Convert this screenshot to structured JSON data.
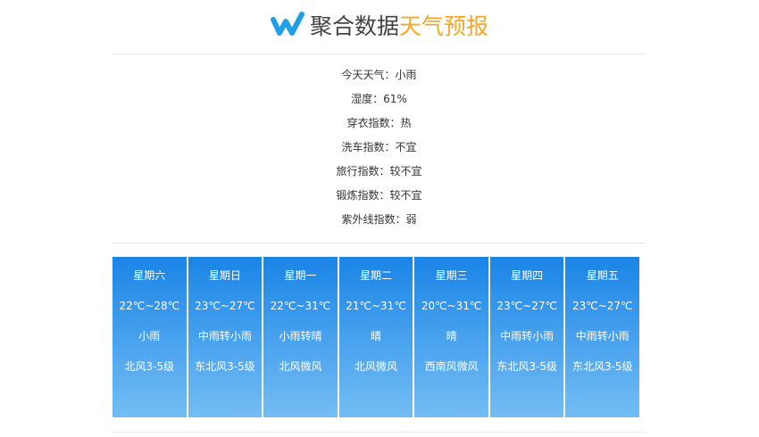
{
  "header": {
    "brand": "聚合数据",
    "accent": "天气预报",
    "logo_icon": "juhe-w-logo-icon",
    "brand_color": "#444444",
    "accent_color": "#f5a623",
    "logo_color": "#1e9fe8"
  },
  "today": [
    {
      "label": "今天天气",
      "value": "小雨"
    },
    {
      "label": "湿度",
      "value": "61%"
    },
    {
      "label": "穿衣指数",
      "value": "热"
    },
    {
      "label": "洗车指数",
      "value": "不宜"
    },
    {
      "label": "旅行指数",
      "value": "较不宜"
    },
    {
      "label": "锻炼指数",
      "value": "较不宜"
    },
    {
      "label": "紫外线指数",
      "value": "弱"
    }
  ],
  "separator": "：",
  "forecast": [
    {
      "week": "星期六",
      "temp": "22℃~28℃",
      "weather": "小雨",
      "wind": "北风3-5级"
    },
    {
      "week": "星期日",
      "temp": "23℃~27℃",
      "weather": "中雨转小雨",
      "wind": "东北风3-5级"
    },
    {
      "week": "星期一",
      "temp": "22℃~31℃",
      "weather": "小雨转晴",
      "wind": "北风微风"
    },
    {
      "week": "星期二",
      "temp": "21℃~31℃",
      "weather": "晴",
      "wind": "北风微风"
    },
    {
      "week": "星期三",
      "temp": "20℃~31℃",
      "weather": "晴",
      "wind": "西南风微风"
    },
    {
      "week": "星期四",
      "temp": "23℃~27℃",
      "weather": "中雨转小雨",
      "wind": "东北风3-5级"
    },
    {
      "week": "星期五",
      "temp": "23℃~27℃",
      "weather": "中雨转小雨",
      "wind": "东北风3-5级"
    }
  ],
  "colors": {
    "card_top": "#1a84e6",
    "card_bottom": "#74bdf3",
    "divider": "#e6e6e6"
  }
}
